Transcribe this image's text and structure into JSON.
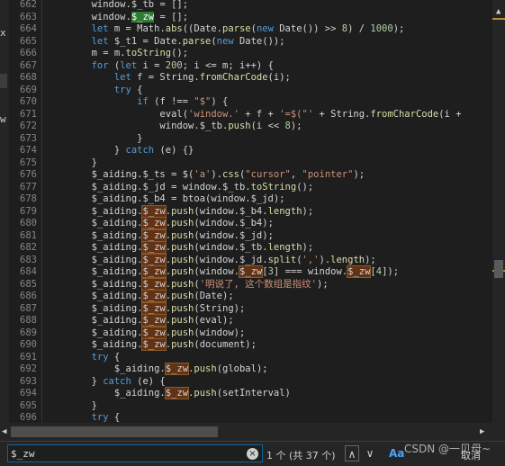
{
  "colors": {
    "keyword": "#569cd6",
    "control": "#569cd6",
    "method": "#dcdcaa",
    "string": "#ce9178",
    "number": "#b5cea8",
    "plain": "#d4d4d4",
    "var": "#9cdcfe",
    "match_bg": "#613214",
    "current_match_bg": "#2f7d32"
  },
  "left_panel": {
    "fragments": [
      "x",
      "w"
    ]
  },
  "editor": {
    "lines": [
      {
        "num": "662",
        "tokens": [
          [
            "        window.",
            "plain"
          ],
          [
            "$_tb",
            "plain"
          ],
          [
            " = [];",
            "plain"
          ]
        ]
      },
      {
        "num": "663",
        "tokens": [
          [
            "        window.",
            "plain"
          ],
          [
            "$_zw",
            "current"
          ],
          [
            " = [];",
            "plain"
          ]
        ]
      },
      {
        "num": "664",
        "tokens": [
          [
            "        ",
            "plain"
          ],
          [
            "let",
            "keyword"
          ],
          [
            " m = Math.",
            "plain"
          ],
          [
            "abs",
            "method"
          ],
          [
            "((Date.",
            "plain"
          ],
          [
            "parse",
            "method"
          ],
          [
            "(",
            "plain"
          ],
          [
            "new",
            "keyword"
          ],
          [
            " Date()) >> ",
            "plain"
          ],
          [
            "8",
            "number"
          ],
          [
            ") / ",
            "plain"
          ],
          [
            "1000",
            "number"
          ],
          [
            ");",
            "plain"
          ]
        ]
      },
      {
        "num": "665",
        "tokens": [
          [
            "        ",
            "plain"
          ],
          [
            "let",
            "keyword"
          ],
          [
            " $_t1 = Date.",
            "plain"
          ],
          [
            "parse",
            "method"
          ],
          [
            "(",
            "plain"
          ],
          [
            "new",
            "keyword"
          ],
          [
            " Date());",
            "plain"
          ]
        ]
      },
      {
        "num": "666",
        "tokens": [
          [
            "        m = m.",
            "plain"
          ],
          [
            "toString",
            "method"
          ],
          [
            "();",
            "plain"
          ]
        ]
      },
      {
        "num": "667",
        "tokens": [
          [
            "        ",
            "plain"
          ],
          [
            "for",
            "keyword"
          ],
          [
            " (",
            "plain"
          ],
          [
            "let",
            "keyword"
          ],
          [
            " i = ",
            "plain"
          ],
          [
            "200",
            "number"
          ],
          [
            "; i <= m; i++) {",
            "plain"
          ]
        ]
      },
      {
        "num": "668",
        "tokens": [
          [
            "            ",
            "plain"
          ],
          [
            "let",
            "keyword"
          ],
          [
            " f = String.",
            "plain"
          ],
          [
            "fromCharCode",
            "method"
          ],
          [
            "(i);",
            "plain"
          ]
        ]
      },
      {
        "num": "669",
        "tokens": [
          [
            "            ",
            "plain"
          ],
          [
            "try",
            "keyword"
          ],
          [
            " {",
            "plain"
          ]
        ]
      },
      {
        "num": "670",
        "tokens": [
          [
            "                ",
            "plain"
          ],
          [
            "if",
            "keyword"
          ],
          [
            " (f !== ",
            "plain"
          ],
          [
            "\"$\"",
            "string"
          ],
          [
            ") {",
            "plain"
          ]
        ]
      },
      {
        "num": "671",
        "tokens": [
          [
            "                    eval(",
            "plain"
          ],
          [
            "'window.'",
            "string"
          ],
          [
            " + f + ",
            "plain"
          ],
          [
            "'=$(\"'",
            "string"
          ],
          [
            " + String.",
            "plain"
          ],
          [
            "fromCharCode",
            "method"
          ],
          [
            "(i + ",
            "plain"
          ]
        ]
      },
      {
        "num": "672",
        "tokens": [
          [
            "                    window.",
            "plain"
          ],
          [
            "$_tb",
            "plain"
          ],
          [
            ".",
            "plain"
          ],
          [
            "push",
            "method"
          ],
          [
            "(i << ",
            "plain"
          ],
          [
            "8",
            "number"
          ],
          [
            ");",
            "plain"
          ]
        ]
      },
      {
        "num": "673",
        "tokens": [
          [
            "                }",
            "plain"
          ]
        ]
      },
      {
        "num": "674",
        "tokens": [
          [
            "            } ",
            "plain"
          ],
          [
            "catch",
            "keyword"
          ],
          [
            " (e) {}",
            "plain"
          ]
        ]
      },
      {
        "num": "675",
        "tokens": [
          [
            "        }",
            "plain"
          ]
        ]
      },
      {
        "num": "676",
        "tokens": [
          [
            "        $_aiding.",
            "plain"
          ],
          [
            "$_ts",
            "plain"
          ],
          [
            " = $(",
            "plain"
          ],
          [
            "'a'",
            "string"
          ],
          [
            ").",
            "plain"
          ],
          [
            "css",
            "method"
          ],
          [
            "(",
            "plain"
          ],
          [
            "\"cursor\"",
            "string"
          ],
          [
            ", ",
            "plain"
          ],
          [
            "\"pointer\"",
            "string"
          ],
          [
            ");",
            "plain"
          ]
        ]
      },
      {
        "num": "677",
        "tokens": [
          [
            "        $_aiding.",
            "plain"
          ],
          [
            "$_jd",
            "plain"
          ],
          [
            " = window.",
            "plain"
          ],
          [
            "$_tb",
            "plain"
          ],
          [
            ".",
            "plain"
          ],
          [
            "toString",
            "method"
          ],
          [
            "();",
            "plain"
          ]
        ]
      },
      {
        "num": "678",
        "tokens": [
          [
            "        $_aiding.",
            "plain"
          ],
          [
            "$_b4",
            "plain"
          ],
          [
            " = btoa(window.",
            "plain"
          ],
          [
            "$_jd",
            "plain"
          ],
          [
            ");",
            "plain"
          ]
        ]
      },
      {
        "num": "679",
        "tokens": [
          [
            "        $_aiding.",
            "plain"
          ],
          [
            "$_zw",
            "match"
          ],
          [
            ".",
            "plain"
          ],
          [
            "push",
            "method"
          ],
          [
            "(window.",
            "plain"
          ],
          [
            "$_b4",
            "plain"
          ],
          [
            ".",
            "plain"
          ],
          [
            "length",
            "method"
          ],
          [
            ");",
            "plain"
          ]
        ]
      },
      {
        "num": "680",
        "tokens": [
          [
            "        $_aiding.",
            "plain"
          ],
          [
            "$_zw",
            "match"
          ],
          [
            ".",
            "plain"
          ],
          [
            "push",
            "method"
          ],
          [
            "(window.",
            "plain"
          ],
          [
            "$_b4",
            "plain"
          ],
          [
            ");",
            "plain"
          ]
        ]
      },
      {
        "num": "681",
        "tokens": [
          [
            "        $_aiding.",
            "plain"
          ],
          [
            "$_zw",
            "match"
          ],
          [
            ".",
            "plain"
          ],
          [
            "push",
            "method"
          ],
          [
            "(window.",
            "plain"
          ],
          [
            "$_jd",
            "plain"
          ],
          [
            ");",
            "plain"
          ]
        ]
      },
      {
        "num": "682",
        "tokens": [
          [
            "        $_aiding.",
            "plain"
          ],
          [
            "$_zw",
            "match"
          ],
          [
            ".",
            "plain"
          ],
          [
            "push",
            "method"
          ],
          [
            "(window.",
            "plain"
          ],
          [
            "$_tb",
            "plain"
          ],
          [
            ".",
            "plain"
          ],
          [
            "length",
            "method"
          ],
          [
            ");",
            "plain"
          ]
        ]
      },
      {
        "num": "683",
        "tokens": [
          [
            "        $_aiding.",
            "plain"
          ],
          [
            "$_zw",
            "match"
          ],
          [
            ".",
            "plain"
          ],
          [
            "push",
            "method"
          ],
          [
            "(window.",
            "plain"
          ],
          [
            "$_jd",
            "plain"
          ],
          [
            ".",
            "plain"
          ],
          [
            "split",
            "method"
          ],
          [
            "(",
            "plain"
          ],
          [
            "','",
            "string"
          ],
          [
            ").",
            "plain"
          ],
          [
            "length",
            "method"
          ],
          [
            ");",
            "plain"
          ]
        ]
      },
      {
        "num": "684",
        "tokens": [
          [
            "        $_aiding.",
            "plain"
          ],
          [
            "$_zw",
            "match"
          ],
          [
            ".",
            "plain"
          ],
          [
            "push",
            "method"
          ],
          [
            "(window.",
            "plain"
          ],
          [
            "$_zw",
            "match"
          ],
          [
            "[",
            "plain"
          ],
          [
            "3",
            "number"
          ],
          [
            "] === window.",
            "plain"
          ],
          [
            "$_zw",
            "match"
          ],
          [
            "[",
            "plain"
          ],
          [
            "4",
            "number"
          ],
          [
            "]);",
            "plain"
          ]
        ]
      },
      {
        "num": "685",
        "tokens": [
          [
            "        $_aiding.",
            "plain"
          ],
          [
            "$_zw",
            "match"
          ],
          [
            ".",
            "plain"
          ],
          [
            "push",
            "method"
          ],
          [
            "(",
            "plain"
          ],
          [
            "'明说了, 这个数组是指纹'",
            "string"
          ],
          [
            ");",
            "plain"
          ]
        ]
      },
      {
        "num": "686",
        "tokens": [
          [
            "        $_aiding.",
            "plain"
          ],
          [
            "$_zw",
            "match"
          ],
          [
            ".",
            "plain"
          ],
          [
            "push",
            "method"
          ],
          [
            "(Date);",
            "plain"
          ]
        ]
      },
      {
        "num": "687",
        "tokens": [
          [
            "        $_aiding.",
            "plain"
          ],
          [
            "$_zw",
            "match"
          ],
          [
            ".",
            "plain"
          ],
          [
            "push",
            "method"
          ],
          [
            "(String);",
            "plain"
          ]
        ]
      },
      {
        "num": "688",
        "tokens": [
          [
            "        $_aiding.",
            "plain"
          ],
          [
            "$_zw",
            "match"
          ],
          [
            ".",
            "plain"
          ],
          [
            "push",
            "method"
          ],
          [
            "(eval);",
            "plain"
          ]
        ]
      },
      {
        "num": "689",
        "tokens": [
          [
            "        $_aiding.",
            "plain"
          ],
          [
            "$_zw",
            "match"
          ],
          [
            ".",
            "plain"
          ],
          [
            "push",
            "method"
          ],
          [
            "(window);",
            "plain"
          ]
        ]
      },
      {
        "num": "690",
        "tokens": [
          [
            "        $_aiding.",
            "plain"
          ],
          [
            "$_zw",
            "match"
          ],
          [
            ".",
            "plain"
          ],
          [
            "push",
            "method"
          ],
          [
            "(document);",
            "plain"
          ]
        ]
      },
      {
        "num": "691",
        "tokens": [
          [
            "        ",
            "plain"
          ],
          [
            "try",
            "keyword"
          ],
          [
            " {",
            "plain"
          ]
        ]
      },
      {
        "num": "692",
        "tokens": [
          [
            "            $_aiding.",
            "plain"
          ],
          [
            "$_zw",
            "match"
          ],
          [
            ".",
            "plain"
          ],
          [
            "push",
            "method"
          ],
          [
            "(global);",
            "plain"
          ]
        ]
      },
      {
        "num": "693",
        "tokens": [
          [
            "        } ",
            "plain"
          ],
          [
            "catch",
            "keyword"
          ],
          [
            " (e) {",
            "plain"
          ]
        ]
      },
      {
        "num": "694",
        "tokens": [
          [
            "            $_aiding.",
            "plain"
          ],
          [
            "$_zw",
            "match"
          ],
          [
            ".",
            "plain"
          ],
          [
            "push",
            "method"
          ],
          [
            "(setInterval)",
            "plain"
          ]
        ]
      },
      {
        "num": "695",
        "tokens": [
          [
            "        }",
            "plain"
          ]
        ]
      },
      {
        "num": "696",
        "tokens": [
          [
            "        ",
            "plain"
          ],
          [
            "try",
            "keyword"
          ],
          [
            " {",
            "plain"
          ]
        ]
      }
    ]
  },
  "find": {
    "query": "$_zw",
    "count": "1 个 (共 37 个)",
    "clear_icon": "×",
    "prev_icon": "∧",
    "next_icon": "∨",
    "match_case_label": "Aa",
    "cancel_label": "取消"
  },
  "watermark": "CSDN @一贝母~"
}
